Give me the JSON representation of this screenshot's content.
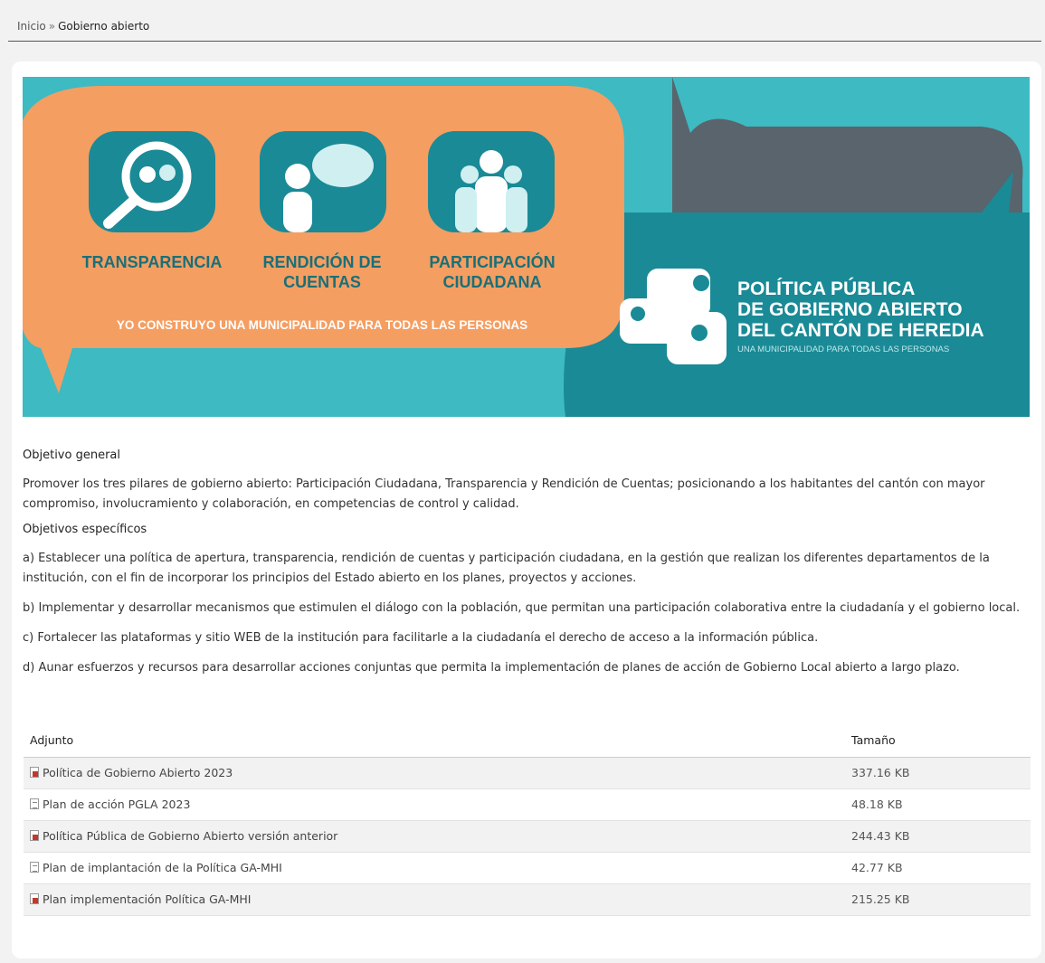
{
  "breadcrumb": {
    "home": "Inicio",
    "separator": "»",
    "current": "Gobierno abierto"
  },
  "banner": {
    "pillars": [
      "TRANSPARENCIA",
      "RENDICIÓN DE",
      "CUENTAS",
      "PARTICIPACIÓN",
      "CIUDADANA"
    ],
    "slogan": "YO CONSTRUYO UNA MUNICIPALIDAD PARA TODAS LAS PERSONAS",
    "policy_line1": "POLÍTICA PÚBLICA",
    "policy_line2": "DE GOBIERNO ABIERTO",
    "policy_line3": "DEL CANTÓN DE HEREDIA",
    "policy_tagline": "UNA MUNICIPALIDAD PARA TODAS LAS PERSONAS",
    "colors": {
      "teal": "#3dbac2",
      "orange": "#f49e62",
      "dark_teal": "#1a8a96",
      "gray": "#5a646c"
    }
  },
  "content": {
    "general_title": "Objetivo general",
    "general_text": "Promover los tres pilares de gobierno abierto: Participación Ciudadana, Transparencia y Rendición de Cuentas; posicionando a los habitantes del cantón con mayor compromiso, involucramiento y colaboración, en competencias de control y calidad.",
    "specific_title": "Objetivos específicos",
    "items": [
      "a) Establecer una política de apertura, transparencia, rendición de cuentas y participación ciudadana, en la gestión que realizan los diferentes departamentos de la institución, con el fin de incorporar los principios del Estado abierto en los planes, proyectos y acciones.",
      "b) Implementar y desarrollar mecanismos que estimulen el diálogo con la población, que permitan una participación colaborativa entre la ciudadanía y el gobierno local.",
      "c) Fortalecer las plataformas y sitio WEB de la institución para facilitarle a la ciudadanía el derecho de acceso a la información pública.",
      "d) Aunar esfuerzos y recursos para desarrollar acciones conjuntas que permita la implementación de planes de acción de Gobierno Local abierto a largo plazo."
    ]
  },
  "attachments": {
    "col_file": "Adjunto",
    "col_size": "Tamaño",
    "rows": [
      {
        "name": "Política de Gobierno Abierto 2023",
        "size": "337.16 KB",
        "icon": "pdf-icon"
      },
      {
        "name": "Plan de acción PGLA 2023",
        "size": "48.18 KB",
        "icon": "document-icon"
      },
      {
        "name": "Política Pública de Gobierno Abierto versión anterior",
        "size": "244.43 KB",
        "icon": "pdf-icon"
      },
      {
        "name": "Plan de implantación de la Política GA-MHI",
        "size": "42.77 KB",
        "icon": "document-icon"
      },
      {
        "name": "Plan implementación Política GA-MHI",
        "size": "215.25 KB",
        "icon": "pdf-icon"
      }
    ]
  }
}
